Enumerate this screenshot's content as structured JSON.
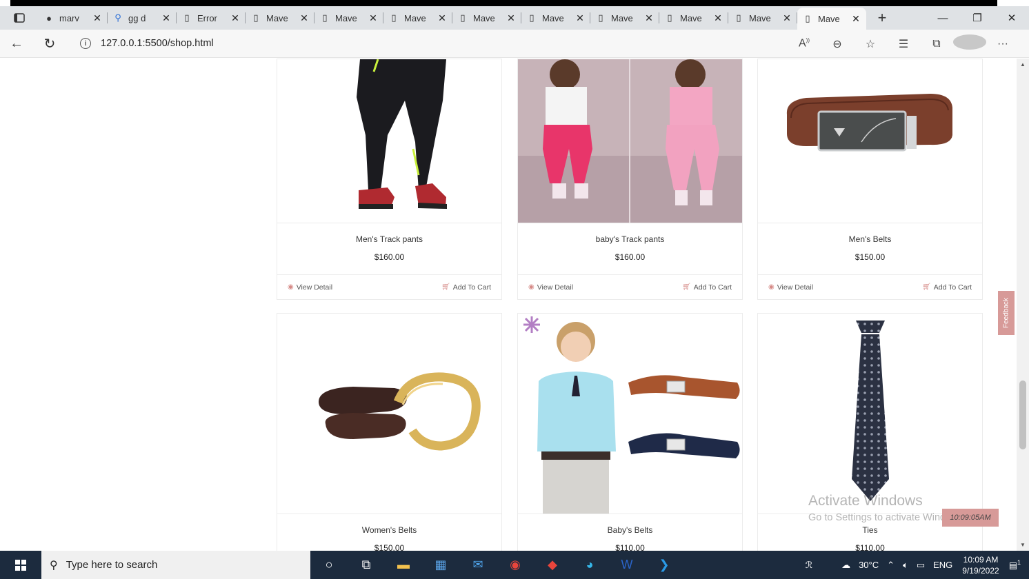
{
  "browser": {
    "tabs": [
      {
        "label": "marv",
        "icon": "github-icon"
      },
      {
        "label": "gg d",
        "icon": "search-icon"
      },
      {
        "label": "Error",
        "icon": "page-icon"
      },
      {
        "label": "Mave",
        "icon": "page-icon"
      },
      {
        "label": "Mave",
        "icon": "page-icon"
      },
      {
        "label": "Mave",
        "icon": "page-icon"
      },
      {
        "label": "Mave",
        "icon": "page-icon"
      },
      {
        "label": "Mave",
        "icon": "page-icon"
      },
      {
        "label": "Mave",
        "icon": "page-icon"
      },
      {
        "label": "Mave",
        "icon": "page-icon"
      },
      {
        "label": "Mave",
        "icon": "page-icon"
      },
      {
        "label": "Mave",
        "icon": "page-icon",
        "active": true
      }
    ],
    "url": "127.0.0.1:5500/shop.html"
  },
  "products": [
    {
      "name": "Men's Track pants",
      "price": "$160.00"
    },
    {
      "name": "baby's Track pants",
      "price": "$160.00"
    },
    {
      "name": "Men's Belts",
      "price": "$150.00"
    },
    {
      "name": "Women's Belts",
      "price": "$150.00"
    },
    {
      "name": "Baby's Belts",
      "price": "$110.00"
    },
    {
      "name": "Ties",
      "price": "$110.00"
    }
  ],
  "card_actions": {
    "view": "View Detail",
    "cart": "Add To Cart"
  },
  "feedback": "Feedback",
  "watermark": {
    "line1": "Activate Windows",
    "line2": "Go to Settings to activate Windows."
  },
  "time_badge": "10:09:05AM",
  "taskbar": {
    "search_placeholder": "Type here to search",
    "weather": "30°C",
    "language": "ENG",
    "time": "10:09 AM",
    "date": "9/19/2022",
    "notifications": "1"
  },
  "colors": {
    "accent": "#d68a87",
    "taskbar": "#1c2b3e"
  }
}
